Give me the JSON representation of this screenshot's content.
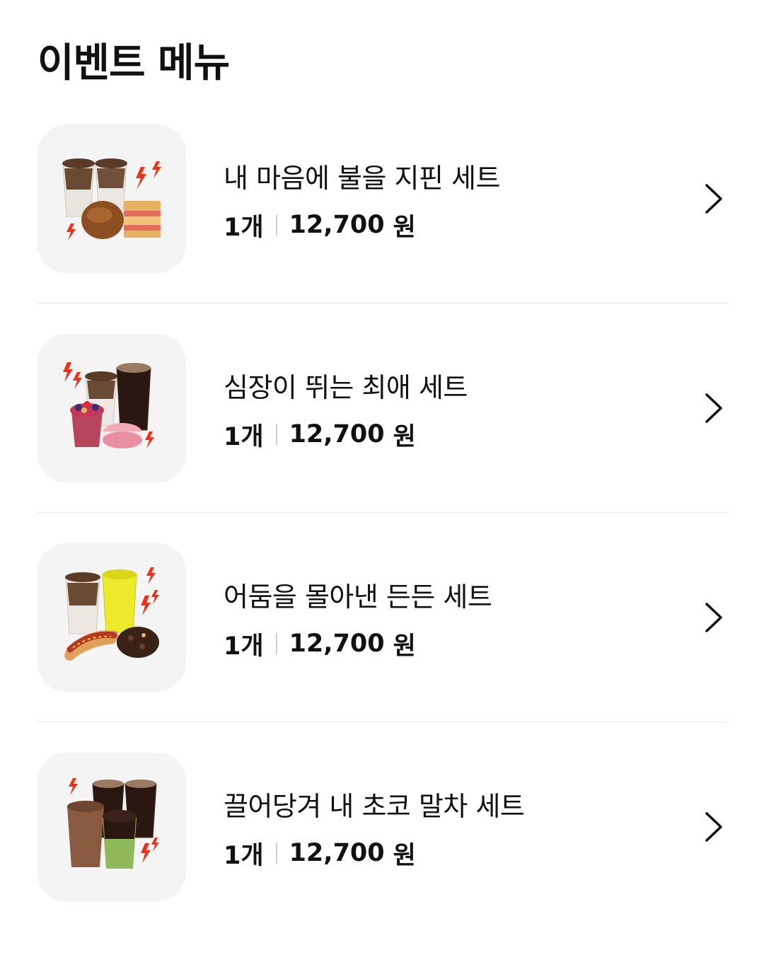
{
  "page_title": "이벤트 메뉴",
  "colors": {
    "thumb_bg": "#f4f4f4",
    "divider": "#e7e7e7",
    "bolt": "#e8341c",
    "text": "#111111"
  },
  "items": [
    {
      "name": "내 마음에 불을 지핀 세트",
      "qty": "1개",
      "price": "12,700",
      "currency": "원",
      "image_icon": "latte-bread-sandwich-set-image"
    },
    {
      "name": "심장이 뛰는 최애 세트",
      "qty": "1개",
      "price": "12,700",
      "currency": "원",
      "image_icon": "coffee-smoothie-macaron-set-image"
    },
    {
      "name": "어둠을 몰아낸 든든 세트",
      "qty": "1개",
      "price": "12,700",
      "currency": "원",
      "image_icon": "latte-ade-hotdog-cookie-set-image"
    },
    {
      "name": "끌어당겨 내 초코 말차 세트",
      "qty": "1개",
      "price": "12,700",
      "currency": "원",
      "image_icon": "choco-matcha-coffee-set-image"
    }
  ]
}
